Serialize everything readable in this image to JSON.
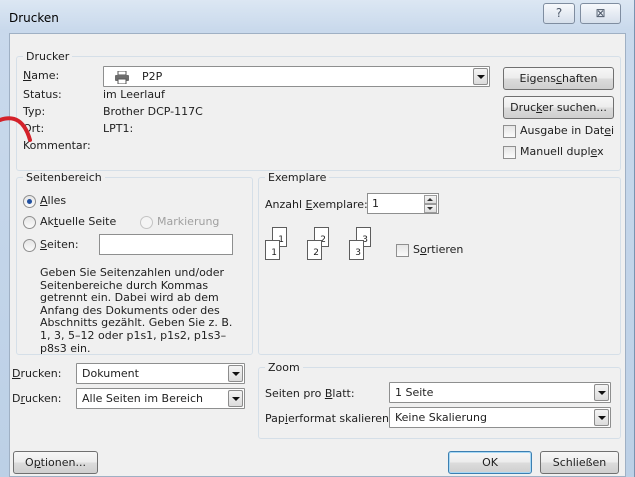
{
  "window": {
    "title": "Drucken",
    "help_label": "?",
    "close_label": "⊠"
  },
  "printer": {
    "group_label": "Drucker",
    "name_label": "Name:",
    "name_value": "P2P",
    "status_label": "Status:",
    "status_value": "im Leerlauf",
    "type_label": "Typ:",
    "type_value": "Brother DCP-117C",
    "location_label": "Ort:",
    "location_value": "LPT1:",
    "comment_label": "Kommentar:",
    "properties_button": "Eigenschaften",
    "find_printer_button": "Drucker suchen...",
    "print_to_file_label": "Ausgabe in Datei",
    "manual_duplex_label": "Manuell duplex"
  },
  "page_range": {
    "group_label": "Seitenbereich",
    "all_label": "Alles",
    "current_page_label": "Aktuelle Seite",
    "selection_label": "Markierung",
    "pages_label": "Seiten:",
    "pages_value": "",
    "help_text": "Geben Sie Seitenzahlen und/oder Seitenbereiche durch Kommas getrennt ein. Dabei wird ab dem Anfang des Dokuments oder des Abschnitts gezählt. Geben Sie z. B. 1, 3, 5–12 oder p1s1, p1s2, p1s3–p8s3 ein."
  },
  "copies": {
    "group_label": "Exemplare",
    "count_label": "Anzahl Exemplare:",
    "count_value": "1",
    "collate_label": "Sortieren",
    "page_numbers": [
      "1",
      "1",
      "2",
      "2",
      "3",
      "3"
    ]
  },
  "print_what": {
    "label": "Drucken:",
    "value": "Dokument"
  },
  "print_scope": {
    "label": "Drucken:",
    "value": "Alle Seiten im Bereich"
  },
  "zoom": {
    "group_label": "Zoom",
    "pages_per_sheet_label": "Seiten pro Blatt:",
    "pages_per_sheet_value": "1 Seite",
    "scale_label": "Papierformat skalieren:",
    "scale_value": "Keine Skalierung"
  },
  "footer": {
    "options_button": "Optionen...",
    "ok_button": "OK",
    "close_button": "Schließen"
  },
  "colors": {
    "accent": "#3c7fb1",
    "annotation": "#d4222a"
  }
}
